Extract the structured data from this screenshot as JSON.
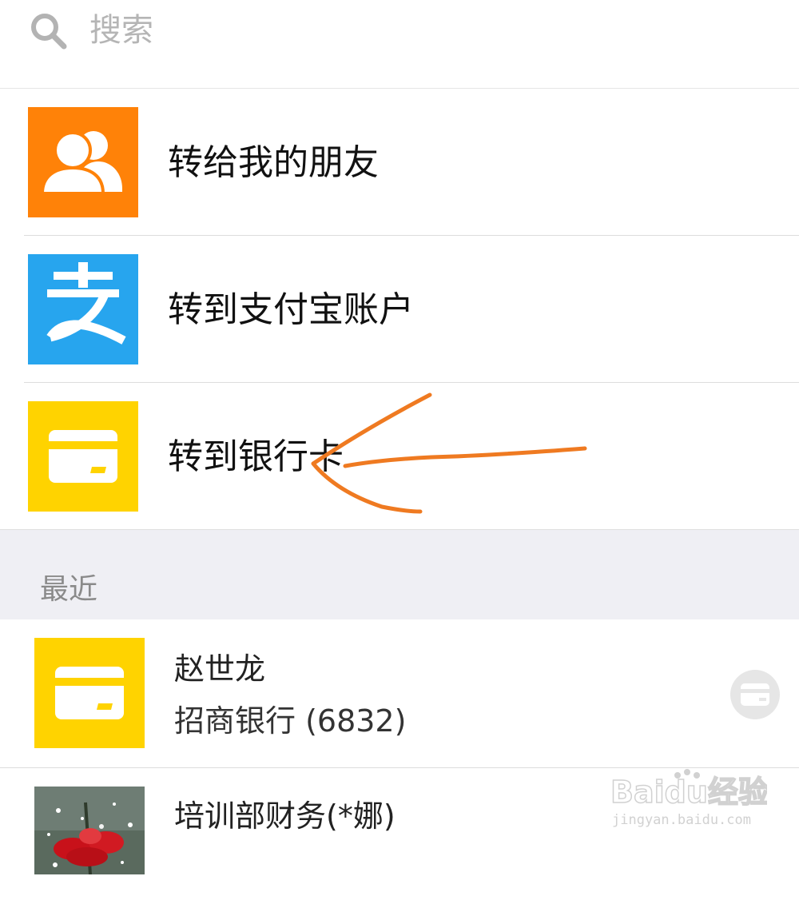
{
  "search": {
    "placeholder": "搜索",
    "icon": "search-icon"
  },
  "options": [
    {
      "label": "转给我的朋友",
      "icon": "friends-icon",
      "color": "#ff8208"
    },
    {
      "label": "转到支付宝账户",
      "icon": "alipay-icon",
      "color": "#27a5ee"
    },
    {
      "label": "转到银行卡",
      "icon": "bank-card-icon",
      "color": "#ffd300"
    }
  ],
  "recent": {
    "title": "最近",
    "items": [
      {
        "name": "赵世龙",
        "detail": "招商银行 (6832)",
        "icon": "bank-card-icon",
        "action_icon": "card-icon"
      },
      {
        "name": "培训部财务(*娜)",
        "avatar": "flower-avatar"
      }
    ]
  },
  "annotation": {
    "type": "arrow",
    "color": "#ef7a21",
    "points_to": "转到银行卡"
  },
  "watermark": {
    "brand": "Baidu经验",
    "url": "jingyan.baidu.com"
  }
}
